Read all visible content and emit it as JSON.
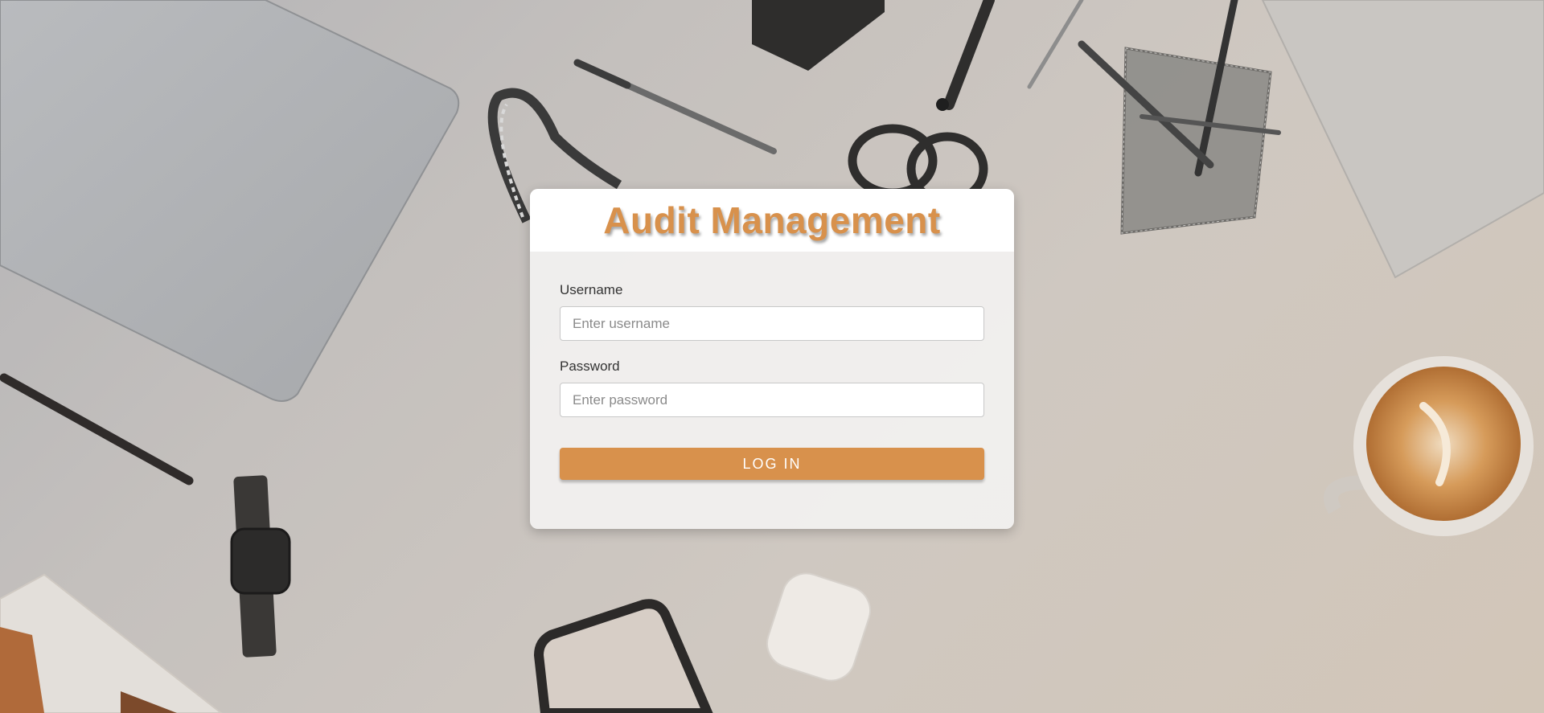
{
  "app": {
    "title": "Audit Management"
  },
  "login_form": {
    "username_label": "Username",
    "username_placeholder": "Enter username",
    "username_value": "",
    "password_label": "Password",
    "password_placeholder": "Enter password",
    "password_value": "",
    "submit_label": "LOG IN"
  },
  "colors": {
    "accent": "#d8914c",
    "card_background": "#f1f0ee",
    "header_background": "#ffffff",
    "label_text": "#333333",
    "placeholder_text": "#8a8a8a"
  },
  "background": {
    "description_items": [
      "laptop-icon",
      "pen-icon",
      "scissors-icon",
      "pencil-cup-icon",
      "notebook-icon",
      "coffee-cup-icon",
      "phone-icon",
      "watch-icon",
      "earbuds-case-icon",
      "cable-icon"
    ]
  }
}
